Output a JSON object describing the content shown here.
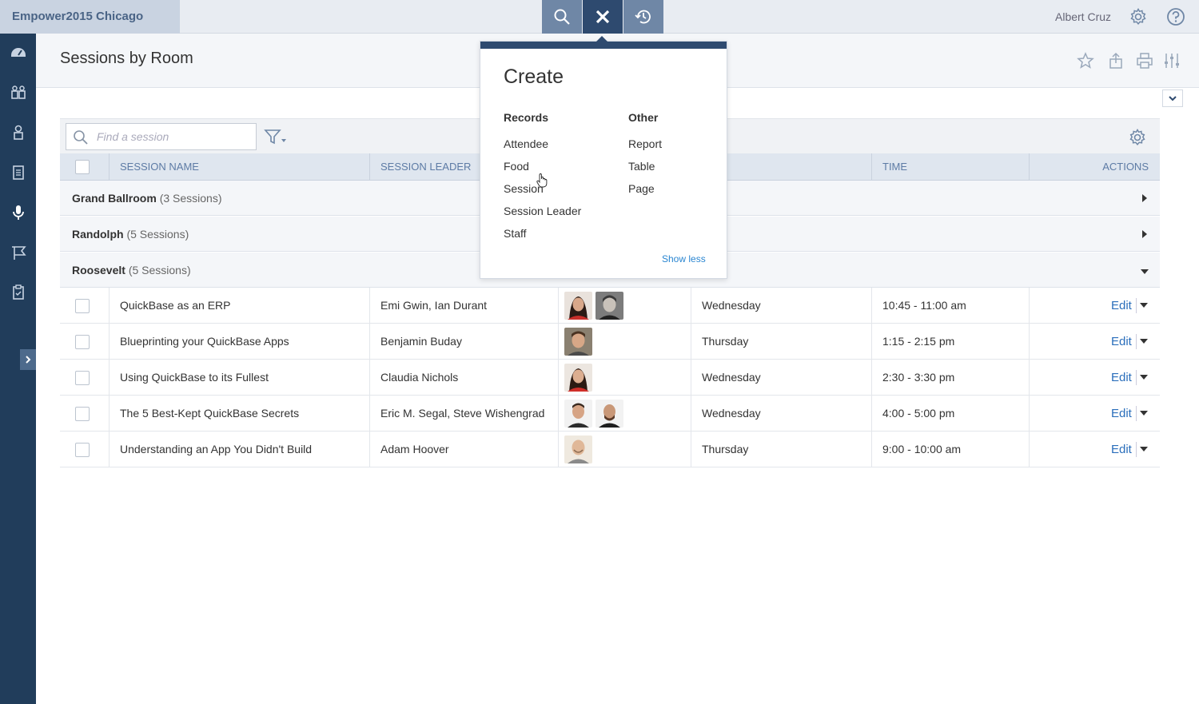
{
  "app": {
    "name": "Empower2015 Chicago"
  },
  "topbar": {
    "user_name": "Albert Cruz"
  },
  "page": {
    "title": "Sessions by Room"
  },
  "search": {
    "placeholder": "Find a session"
  },
  "table": {
    "headers": [
      "SESSION NAME",
      "SESSION LEADER",
      "TIME",
      "ACTIONS"
    ],
    "groups": [
      {
        "name": "Grand Ballroom",
        "count": "(3 Sessions)",
        "expanded": false
      },
      {
        "name": "Randolph",
        "count": "(5 Sessions)",
        "expanded": false
      },
      {
        "name": "Roosevelt",
        "count": "(5 Sessions)",
        "expanded": true
      }
    ],
    "rows": [
      {
        "session": "QuickBase as an ERP",
        "leader": "Emi Gwin, Ian Durant",
        "day": "Wednesday",
        "time": "10:45 - 11:00 am",
        "action": "Edit"
      },
      {
        "session": "Blueprinting your QuickBase Apps",
        "leader": "Benjamin Buday",
        "day": "Thursday",
        "time": "1:15 - 2:15 pm",
        "action": "Edit"
      },
      {
        "session": "Using QuickBase to its Fullest",
        "leader": "Claudia Nichols",
        "day": "Wednesday",
        "time": "2:30 - 3:30 pm",
        "action": "Edit"
      },
      {
        "session": "The 5 Best-Kept QuickBase Secrets",
        "leader": "Eric M. Segal, Steve Wishengrad",
        "day": "Wednesday",
        "time": "4:00 - 5:00 pm",
        "action": "Edit"
      },
      {
        "session": "Understanding an App You Didn't Build",
        "leader": "Adam Hoover",
        "day": "Thursday",
        "time": "9:00 - 10:00 am",
        "action": "Edit"
      }
    ]
  },
  "create_popup": {
    "title": "Create",
    "records_heading": "Records",
    "other_heading": "Other",
    "records": [
      "Attendee",
      "Food",
      "Session",
      "Session Leader",
      "Staff"
    ],
    "other": [
      "Report",
      "Table",
      "Page"
    ],
    "show_less": "Show less"
  },
  "colors": {
    "sidebar": "#213d5b",
    "accent": "#2e4a6f",
    "link": "#2a6ebb"
  },
  "icons": [
    "search-icon",
    "close-icon",
    "history-icon",
    "gear-icon",
    "help-icon",
    "star-icon",
    "share-icon",
    "print-icon",
    "sliders-icon",
    "filter-icon",
    "chevron-down-icon",
    "dashboard-icon",
    "users-icon",
    "person-icon",
    "document-icon",
    "microphone-icon",
    "flag-icon",
    "clipboard-icon"
  ]
}
